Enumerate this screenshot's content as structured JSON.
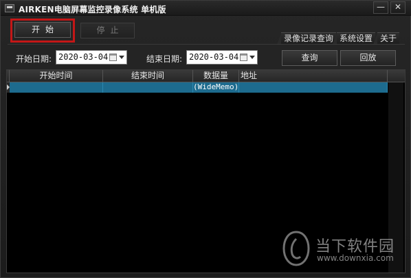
{
  "window": {
    "title": "AIRKEN电脑屏幕监控录像系统 单机版",
    "minimize_glyph": "—",
    "close_glyph": "✕"
  },
  "toolbar": {
    "start_label": "开始",
    "stop_label": "停止"
  },
  "tabs": [
    {
      "label": "录像记录查询"
    },
    {
      "label": "系统设置"
    },
    {
      "label": "关于"
    }
  ],
  "filters": {
    "start_label": "开始日期:",
    "start_value": "2020-03-04",
    "end_label": "结束日期:",
    "end_value": "2020-03-04",
    "query_label": "查询",
    "playback_label": "回放"
  },
  "grid": {
    "columns": [
      "开始时间",
      "结束时间",
      "数据量",
      "地址"
    ],
    "rows": [
      {
        "start": "",
        "end": "",
        "size": "(WideMemo)",
        "address": ""
      }
    ]
  },
  "watermark": {
    "text": "当下软件园",
    "url": "www.downxia.com"
  },
  "colors": {
    "background": "#1f1f1f",
    "selected_row": "#1d6b8e",
    "highlight_border": "#c41717"
  }
}
